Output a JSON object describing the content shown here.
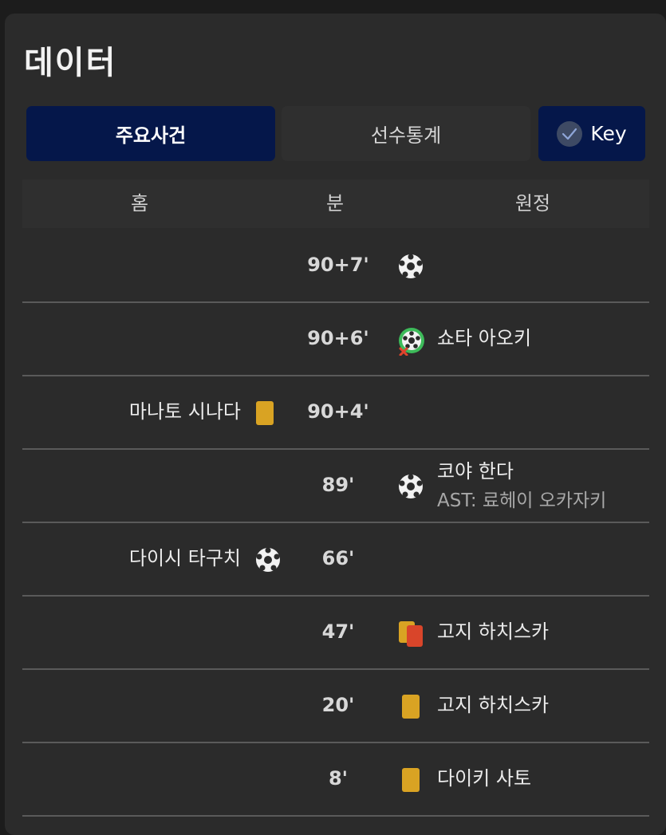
{
  "title": "데이터",
  "tabs": {
    "events_label": "주요사건",
    "stats_label": "선수통계",
    "key_label": "Key"
  },
  "header": {
    "home": "홈",
    "minute": "분",
    "away": "원정"
  },
  "colors": {
    "tab_active": "#05174a",
    "yellow_card": "#d9a323",
    "red_card": "#d9452a",
    "own_goal_ring": "#3dbb5a"
  },
  "events": [
    {
      "minute": "90+7'",
      "home_player": "",
      "away_player": "",
      "away_icon": "goal-icon",
      "assist": ""
    },
    {
      "minute": "90+6'",
      "home_player": "",
      "away_player": "쇼타 아오키",
      "away_icon": "own-goal-icon",
      "assist": ""
    },
    {
      "minute": "90+4'",
      "home_player": "마나토 시나다",
      "home_icon": "yellow-card-icon",
      "away_player": "",
      "assist": ""
    },
    {
      "minute": "89'",
      "home_player": "",
      "away_player": "코야 한다",
      "away_icon": "goal-icon",
      "assist": "AST: 료헤이 오카자키"
    },
    {
      "minute": "66'",
      "home_player": "다이시 타구치",
      "home_icon": "goal-icon",
      "away_player": "",
      "assist": ""
    },
    {
      "minute": "47'",
      "home_player": "",
      "away_player": "고지 하치스카",
      "away_icon": "second-yellow-red-card-icon",
      "assist": ""
    },
    {
      "minute": "20'",
      "home_player": "",
      "away_player": "고지 하치스카",
      "away_icon": "yellow-card-icon",
      "assist": ""
    },
    {
      "minute": "8'",
      "home_player": "",
      "away_player": "다이키 사토",
      "away_icon": "yellow-card-icon",
      "assist": ""
    }
  ]
}
